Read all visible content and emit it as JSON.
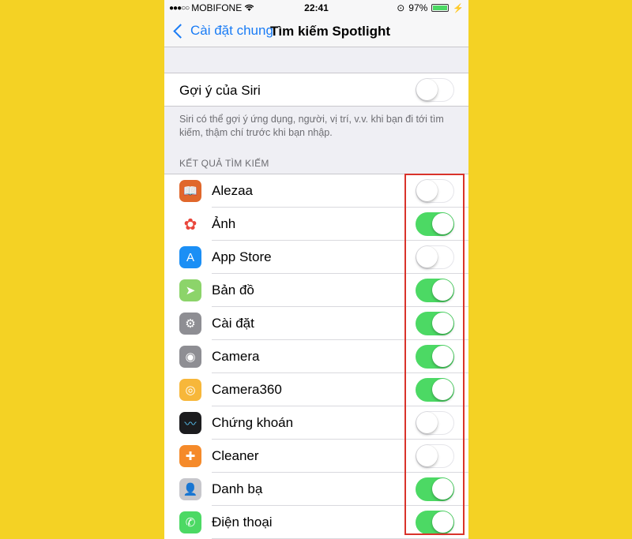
{
  "status_bar": {
    "carrier": "MOBIFONE",
    "time": "22:41",
    "battery": "97%"
  },
  "nav": {
    "back_label": "Cài đặt chung",
    "title": "Tìm kiếm Spotlight"
  },
  "siri": {
    "label": "Gợi ý của Siri",
    "enabled": false,
    "footnote": "Siri có thể gợi ý ứng dụng, người, vị trí, v.v. khi bạn đi tới tìm kiếm, thậm chí trước khi bạn nhập."
  },
  "section_header": "KẾT QUẢ TÌM KIẾM",
  "apps": [
    {
      "label": "Alezaa",
      "icon": "book-icon",
      "color": "#e0672b",
      "enabled": false
    },
    {
      "label": "Ảnh",
      "icon": "photos-icon",
      "color": "#ffffff",
      "enabled": true
    },
    {
      "label": "App Store",
      "icon": "app-store-icon",
      "color": "#1b8ff5",
      "enabled": false
    },
    {
      "label": "Bản đồ",
      "icon": "maps-icon",
      "color": "#8cd46a",
      "enabled": true
    },
    {
      "label": "Cài đặt",
      "icon": "settings-icon",
      "color": "#8e8e93",
      "enabled": true
    },
    {
      "label": "Camera",
      "icon": "camera-icon",
      "color": "#8e8e93",
      "enabled": true
    },
    {
      "label": "Camera360",
      "icon": "camera360-icon",
      "color": "#f7b73a",
      "enabled": true
    },
    {
      "label": "Chứng khoán",
      "icon": "stocks-icon",
      "color": "#1c1c1e",
      "enabled": false
    },
    {
      "label": "Cleaner",
      "icon": "cleaner-icon",
      "color": "#f58a2a",
      "enabled": false
    },
    {
      "label": "Danh bạ",
      "icon": "contacts-icon",
      "color": "#c7c7cc",
      "enabled": true
    },
    {
      "label": "Điện thoại",
      "icon": "phone-icon",
      "color": "#4cd964",
      "enabled": true
    }
  ],
  "colors": {
    "background": "#f4d224",
    "accent": "#1a7cf5",
    "toggle_on": "#4cd964",
    "highlight": "#d9332b"
  }
}
